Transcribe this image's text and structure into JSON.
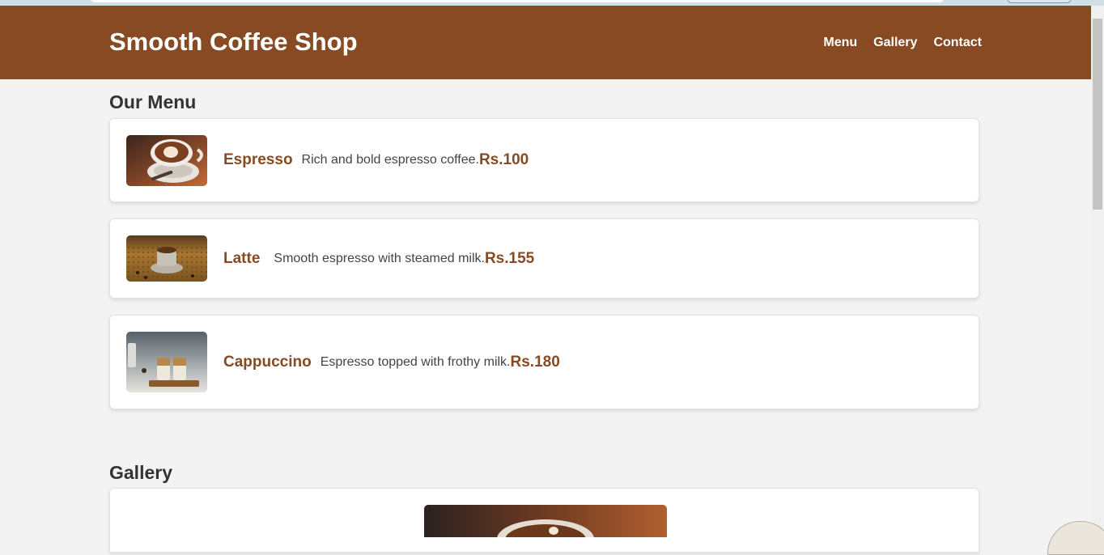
{
  "header": {
    "title": "Smooth Coffee Shop",
    "nav": [
      "Menu",
      "Gallery",
      "Contact"
    ]
  },
  "menu": {
    "heading": "Our Menu",
    "items": [
      {
        "name": "Espresso",
        "description": "Rich and bold espresso coffee.",
        "price": "Rs.100",
        "image": "latte-art-cup-photo"
      },
      {
        "name": "Latte",
        "description": "Smooth espresso with steamed milk.",
        "price": "Rs.155",
        "image": "coffee-cup-on-beans-photo"
      },
      {
        "name": "Cappuccino",
        "description": "Espresso topped with frothy milk.",
        "price": "Rs.180",
        "image": "iced-coffee-glasses-photo"
      }
    ]
  },
  "gallery": {
    "heading": "Gallery",
    "image": "coffee-latte-art-photo"
  },
  "colors": {
    "brand": "#874a22",
    "background": "#f3f3f3",
    "card": "#ffffff"
  }
}
